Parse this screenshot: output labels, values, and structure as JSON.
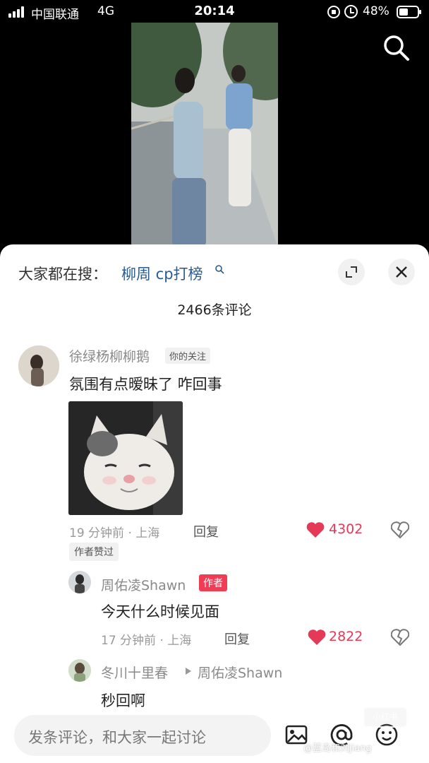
{
  "status_bar": {
    "carrier": "中国联通",
    "network": "4G",
    "time": "20:14",
    "battery": "48%",
    "icons": [
      "signal-icon",
      "lock-rotation-icon",
      "alarm-icon",
      "battery-icon"
    ]
  },
  "video": {
    "search_icon": "search-icon"
  },
  "sheet": {
    "trending_prefix": "大家都在搜：",
    "trending_term": "柳周 cp打榜",
    "comment_count": "2466条评论",
    "icons": [
      "expand-icon",
      "close-icon"
    ]
  },
  "comments": [
    {
      "username": "徐绿杨柳柳鹅",
      "tag": "你的关注",
      "text": "氛围有点暧昧了 咋回事",
      "meta": "19 分钟前 · 上海",
      "reply_label": "回复",
      "likes": "4302",
      "badge": "作者赞过",
      "has_image": true,
      "replies": [
        {
          "username": "周佑凌Shawn",
          "tag": "作者",
          "text": "今天什么时候见面",
          "meta": "17 分钟前 · 上海",
          "reply_label": "回复",
          "likes": "2822"
        },
        {
          "username": "冬川十里春",
          "reply_to": "周佑凌Shawn",
          "text": "秒回啊"
        }
      ]
    }
  ],
  "bottom_bar": {
    "placeholder": "发条评论，和大家一起讨论",
    "icons": [
      "image-icon",
      "at-icon",
      "emoji-icon"
    ]
  },
  "watermark": {
    "logo_text": "小红书",
    "text": "@蓝岛和刘jiang"
  },
  "colors": {
    "like": "#e53958",
    "author_tag": "#f03c55",
    "link": "#2b5a8e"
  }
}
